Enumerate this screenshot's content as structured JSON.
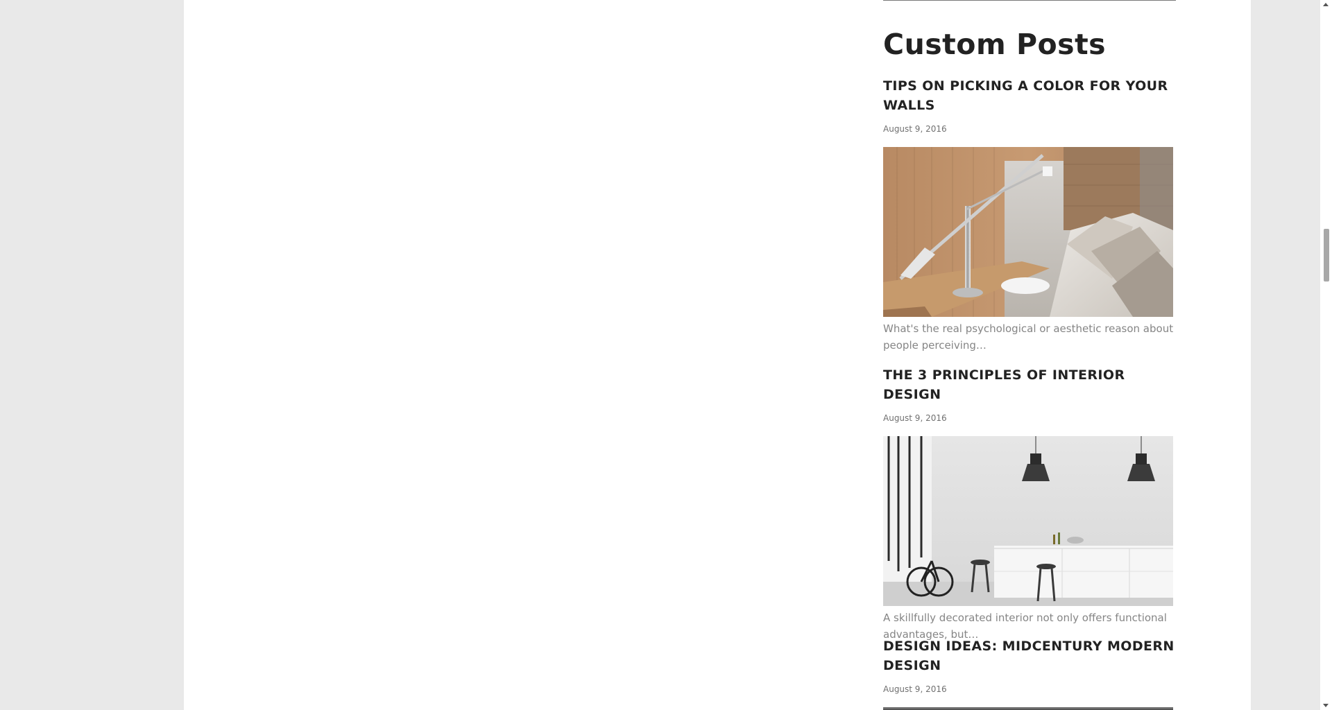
{
  "sidebar": {
    "widget_title": "Custom Posts",
    "posts": [
      {
        "title": "TIPS ON PICKING A COLOR FOR YOUR WALLS",
        "date": "August 9, 2016",
        "excerpt": "What's the real psychological or aesthetic reason about people perceiving…"
      },
      {
        "title": "THE 3 PRINCIPLES OF INTERIOR DESIGN",
        "date": "August 9, 2016",
        "excerpt": "A skillfully decorated interior not only offers functional advantages, but…"
      },
      {
        "title": "DESIGN IDEAS: MIDCENTURY MODERN DESIGN",
        "date": "August 9, 2016",
        "excerpt": ""
      }
    ]
  },
  "colors": {
    "page_background": "#e9e9e9",
    "content_background": "#ffffff",
    "heading": "#222222",
    "date": "#707070",
    "excerpt": "#858585"
  }
}
